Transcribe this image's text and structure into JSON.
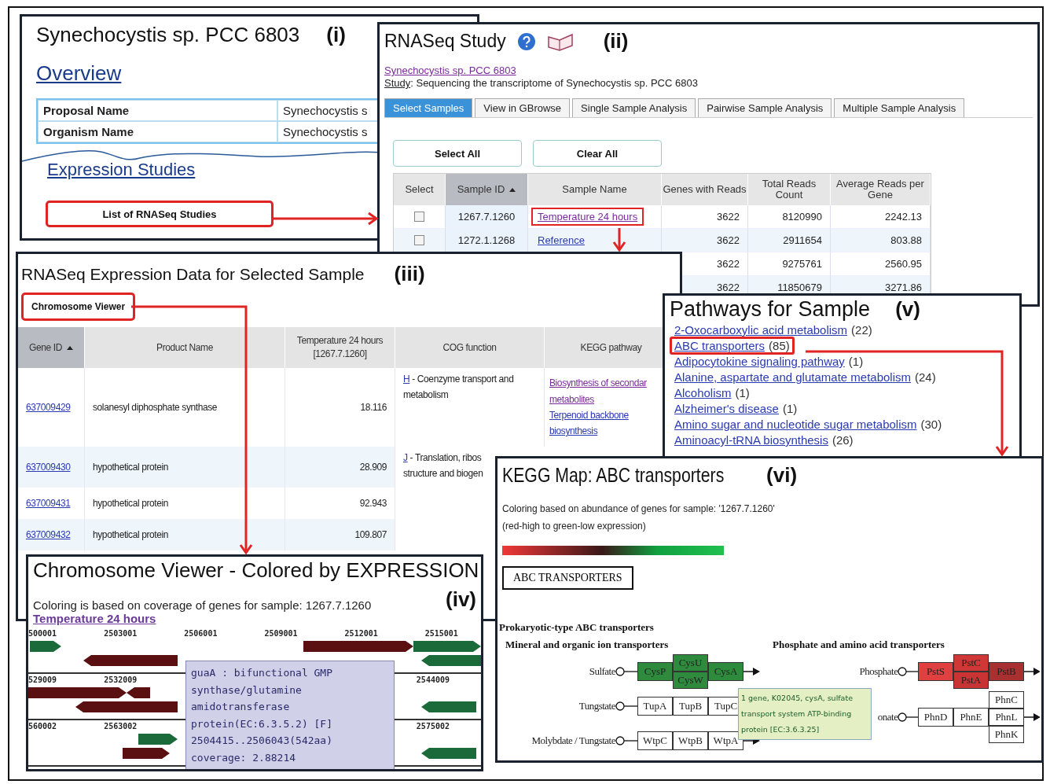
{
  "panel_i": {
    "title": "Synechocystis sp. PCC 6803",
    "tag": "(i)",
    "overview_link": "Overview",
    "info_rows": [
      {
        "label": "Proposal Name",
        "value": "Synechocystis s"
      },
      {
        "label": "Organism Name",
        "value": "Synechocystis s"
      }
    ],
    "section_link": "Expression Studies",
    "button": {
      "label": "List of RNASeq Studies",
      "highlighted": true
    }
  },
  "panel_ii": {
    "title": "RNASeq Study",
    "tag": "(ii)",
    "organism_link": "Synechocystis sp. PCC 6803",
    "study_label": "Study",
    "study_text": ": Sequencing the transcriptome of Synechocystis sp. PCC 6803",
    "tabs": [
      {
        "label": "Select Samples",
        "selected": true
      },
      {
        "label": "View in GBrowse",
        "selected": false
      },
      {
        "label": "Single Sample Analysis",
        "selected": false
      },
      {
        "label": "Pairwise Sample Analysis",
        "selected": false
      },
      {
        "label": "Multiple Sample Analysis",
        "selected": false
      }
    ],
    "buttons": [
      "Select All",
      "Clear All"
    ],
    "columns": [
      "Select",
      "Sample ID",
      "Sample Name",
      "Genes with Reads",
      "Total Reads Count",
      "Average Reads per Gene"
    ],
    "rows": [
      {
        "checked": false,
        "sample_id": "1267.7.1260",
        "sample_name": "Temperature 24 hours",
        "highlighted": true,
        "genes": "3622",
        "total": "8120990",
        "average": "2242.13"
      },
      {
        "checked": false,
        "sample_id": "1272.1.1268",
        "sample_name": "Reference",
        "highlighted": false,
        "genes": "3622",
        "total": "2911654",
        "average": "803.88"
      },
      {
        "genes": "3622",
        "total": "9275761",
        "average": "2560.95"
      },
      {
        "genes": "3622",
        "total": "11850679",
        "average": "3271.86"
      }
    ]
  },
  "panel_iii": {
    "title": "RNASeq Expression Data for Selected Sample",
    "tag": "(iii)",
    "button": {
      "label": "Chromosome Viewer",
      "highlighted": true
    },
    "columns": [
      "Gene ID",
      "Product Name",
      "Temperature 24 hours [1267.7.1260]",
      "COG function",
      "KEGG pathway"
    ],
    "rows": [
      {
        "gene_id": "637009429",
        "product": "solanesyl diphosphate synthase",
        "value": "18.116",
        "cog_code": "H",
        "cog_lines": [
          "- Coenzyme transport and",
          "metabolism"
        ],
        "kegg": [
          "Biosynthesis of secondar",
          "metabolites",
          "Terpenoid backbone",
          "biosynthesis"
        ]
      },
      {
        "gene_id": "637009430",
        "product": "hypothetical protein",
        "value": "28.909",
        "cog_code": "J",
        "cog_lines": [
          "- Translation, ribos",
          "structure and biogen"
        ]
      },
      {
        "gene_id": "637009431",
        "product": "hypothetical protein",
        "value": "92.943"
      },
      {
        "gene_id": "637009432",
        "product": "hypothetical protein",
        "value": "109.807"
      }
    ]
  },
  "panel_iv": {
    "title": "Chromosome Viewer - Colored by EXPRESSION",
    "tag": "(iv)",
    "description": "Coloring is based on coverage of genes for sample: 1267.7.1260",
    "sample_link": "Temperature 24 hours",
    "tracks": [
      {
        "positions": [
          "500001",
          "2503001",
          "2506001",
          "2509001",
          "2512001",
          "2515001"
        ]
      },
      {
        "positions": [
          "529009",
          "2532009",
          "2544009"
        ]
      },
      {
        "positions": [
          "560002",
          "2563002",
          "2575002"
        ]
      }
    ],
    "tooltip": [
      "guaA : bifunctional GMP",
      "synthase/glutamine",
      "amidotransferase",
      "protein(EC:6.3.5.2) [F]",
      "2504415..2506043(542aa)",
      "coverage: 2.88214"
    ]
  },
  "panel_v": {
    "title": "Pathways for Sample",
    "tag": "(v)",
    "pathways": [
      {
        "name": "2-Oxocarboxylic acid metabolism",
        "count": "(22)",
        "highlighted": false
      },
      {
        "name": "ABC transporters",
        "count": "(85)",
        "highlighted": true
      },
      {
        "name": "Adipocytokine signaling pathway",
        "count": "(1)",
        "highlighted": false
      },
      {
        "name": "Alanine, aspartate and glutamate metabolism",
        "count": "(24)",
        "highlighted": false
      },
      {
        "name": "Alcoholism",
        "count": "(1)",
        "highlighted": false
      },
      {
        "name": "Alzheimer's disease",
        "count": "(1)",
        "highlighted": false
      },
      {
        "name": "Amino sugar and nucleotide sugar metabolism",
        "count": "(30)",
        "highlighted": false
      },
      {
        "name": "Aminoacyl-tRNA biosynthesis",
        "count": "(26)",
        "highlighted": false
      }
    ]
  },
  "panel_vi": {
    "title": "KEGG Map: ABC transporters",
    "tag": "(vi)",
    "description": [
      "Coloring based on abundance of genes for sample: '1267.7.1260'",
      "(red-high to green-low expression)"
    ],
    "map_title": "ABC TRANSPORTERS",
    "category": "Prokaryotic-type ABC transporters",
    "groups": [
      {
        "title": "Mineral and organic ion transporters",
        "rows": [
          {
            "label": "Sulfate",
            "slots": [
              [
                {
                  "name": "CysP",
                  "color": "#2e8b3e"
                }
              ],
              [
                {
                  "name": "CysU",
                  "color": "#2e8b3e"
                },
                {
                  "name": "CysW",
                  "color": "#2e8b3e"
                }
              ],
              [
                {
                  "name": "CysA",
                  "color": "#2e8b3e"
                }
              ]
            ]
          },
          {
            "label": "Tungstate",
            "slots": [
              [
                {
                  "name": "TupA",
                  "color": "#ffffff"
                }
              ],
              [
                {
                  "name": "TupB",
                  "color": "#ffffff"
                }
              ],
              [
                {
                  "name": "TupC",
                  "color": "#ffffff"
                }
              ]
            ]
          },
          {
            "label": "Molybdate / Tungstate",
            "slots": [
              [
                {
                  "name": "WtpC",
                  "color": "#ffffff"
                }
              ],
              [
                {
                  "name": "WtpB",
                  "color": "#ffffff"
                }
              ],
              [
                {
                  "name": "WtpA",
                  "color": "#ffffff"
                }
              ]
            ]
          }
        ]
      },
      {
        "title": "Phosphate and amino acid transporters",
        "rows": [
          {
            "label": "Phosphate",
            "slots": [
              [
                {
                  "name": "PstS",
                  "color": "#e04040"
                }
              ],
              [
                {
                  "name": "PstC",
                  "color": "#d03838"
                },
                {
                  "name": "PstA",
                  "color": "#c83434"
                }
              ],
              [
                {
                  "name": "PstB",
                  "color": "#a83030"
                }
              ]
            ]
          },
          {
            "label": "onate",
            "slots": [
              [
                {
                  "name": "PhnD",
                  "color": "#ffffff"
                }
              ],
              [
                {
                  "name": "PhnE",
                  "color": "#ffffff"
                }
              ],
              [
                {
                  "name": "PhnC",
                  "color": "#ffffff"
                },
                {
                  "name": "PhnL",
                  "color": "#ffffff"
                },
                {
                  "name": "PhnK",
                  "color": "#ffffff"
                }
              ]
            ]
          }
        ]
      }
    ],
    "tooltip": "1 gene, K02045, cysA, sulfate transport system ATP-binding protein [EC:3.6.3.25]"
  }
}
